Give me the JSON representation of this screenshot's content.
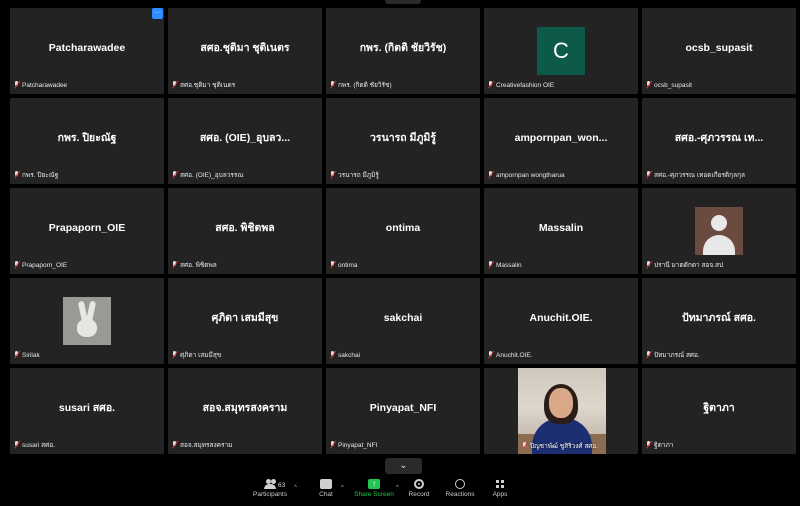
{
  "participants_grid": {
    "rows": [
      [
        {
          "name": "Patcharawadee",
          "caption": "Patcharawadee",
          "avatar": "none"
        },
        {
          "name": "สศอ.ชุติมา ชุติเนตร",
          "caption": "สศอ.ชุติมา ชุติเนตร",
          "avatar": "none"
        },
        {
          "name": "กพร. (กิตติ ชัยวิรัช)",
          "caption": "กพร. (กิตติ ชัยวิรัช)",
          "avatar": "none"
        },
        {
          "name": "",
          "caption": "Creativefashion OIE",
          "avatar": "letter",
          "letter": "C"
        },
        {
          "name": "ocsb_supasit",
          "caption": "ocsb_supasit",
          "avatar": "none"
        }
      ],
      [
        {
          "name": "กพร. ปิยะณัฐ",
          "caption": "กพร. ปิยะณัฐ",
          "avatar": "none"
        },
        {
          "name": "สศอ. (OIE)_อุบลว...",
          "caption": "สศอ. (OIE)_อุบลวรรณ",
          "avatar": "none"
        },
        {
          "name": "วรนารถ มีภูมิรู้",
          "caption": "วรนารถ มีภูมิรู้",
          "avatar": "none"
        },
        {
          "name": "ampornpan_won...",
          "caption": "ampornpan wongtharua",
          "avatar": "none"
        },
        {
          "name": "สศอ.-ศุภวรรณ เท...",
          "caption": "สศอ.-ศุภวรรณ เทอดเกียรติกุลกุล",
          "avatar": "none"
        }
      ],
      [
        {
          "name": "Prapaporn_OIE",
          "caption": "Prapaporn_OIE",
          "avatar": "none"
        },
        {
          "name": "สศอ. พิชิตพล",
          "caption": "สศอ. พิชิตพล",
          "avatar": "none"
        },
        {
          "name": "ontima",
          "caption": "ontima",
          "avatar": "none"
        },
        {
          "name": "Massalin",
          "caption": "Massalin",
          "avatar": "none"
        },
        {
          "name": "",
          "caption": "ปรานี มาตตักดา สอจ.สป",
          "avatar": "person"
        }
      ],
      [
        {
          "name": "",
          "caption": "Sirilak",
          "avatar": "rabbit"
        },
        {
          "name": "ศุภิดา เสมมีสุข",
          "caption": "ศุภิดา เสมมีสุข",
          "avatar": "none"
        },
        {
          "name": "sakchai",
          "caption": "sakchai",
          "avatar": "none"
        },
        {
          "name": "Anuchit.OIE.",
          "caption": "Anuchit.OIE.",
          "avatar": "none"
        },
        {
          "name": "ปัทมาภรณ์ สศอ.",
          "caption": "ปัทมาภรณ์ สศอ.",
          "avatar": "none"
        }
      ],
      [
        {
          "name": "susari สศอ.",
          "caption": "susari สศอ.",
          "avatar": "none"
        },
        {
          "name": "สอจ.สมุทรสงคราม",
          "caption": "สอจ.สมุทรสงคราม",
          "avatar": "none"
        },
        {
          "name": "Pinyapat_NFI",
          "caption": "Pinyapat_NFI",
          "avatar": "none"
        },
        {
          "name": "",
          "caption": "ปิญชาพัฒ์ ชูสิริวงศ์ สศอ.",
          "avatar": "video"
        },
        {
          "name": "ฐิตาภา",
          "caption": "ฐิตาภา",
          "avatar": "none"
        }
      ]
    ]
  },
  "more_badge": "···",
  "collapse_icon": "⌄",
  "toolbar": {
    "participants_label": "Participants",
    "participants_count": "63",
    "chat_label": "Chat",
    "share_label": "Share Screen",
    "record_label": "Record",
    "reactions_label": "Reactions",
    "apps_label": "Apps",
    "caret": "^",
    "share_icon": "↑",
    "accent_green": "#23c552"
  }
}
